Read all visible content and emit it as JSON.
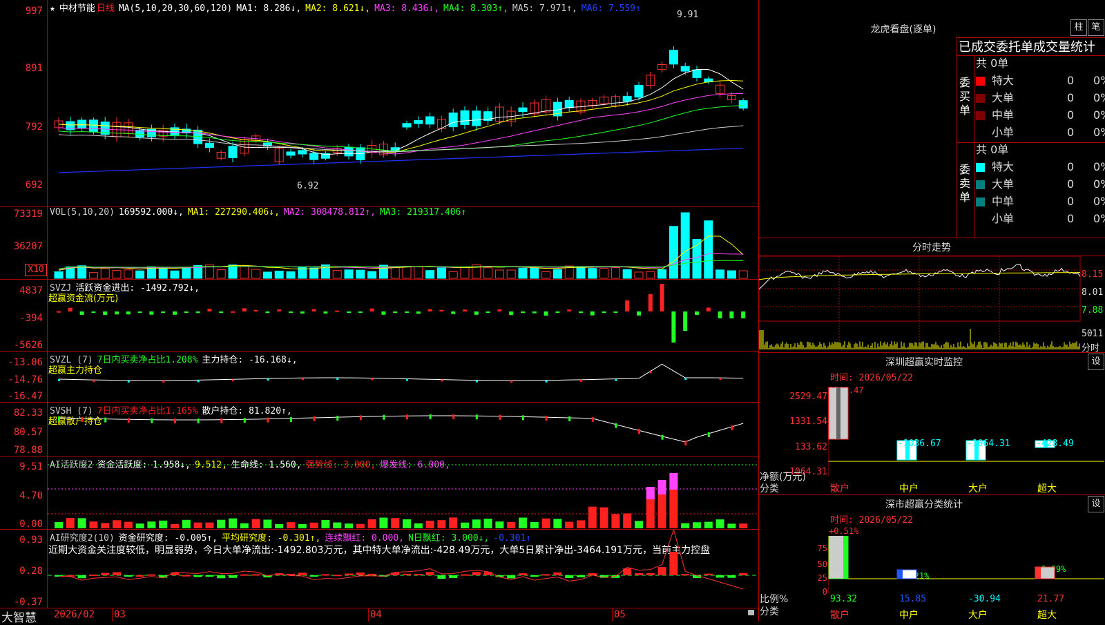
{
  "stock": {
    "star": "★",
    "name": "中材节能",
    "period": "日线",
    "ma_header": "MA(5,10,20,30,60,120)",
    "ma1": "MA1: 8.286↓,",
    "ma2": "MA2: 8.621↓,",
    "ma3": "MA3: 8.436↓,",
    "ma4": "MA4: 8.303↑,",
    "ma5": "MA5: 7.971↑,",
    "ma6": "MA6: 7.559↑",
    "high_mark": "9.91",
    "low_mark": "6.92"
  },
  "price_axis": [
    "997",
    "891",
    "792",
    "692"
  ],
  "vol": {
    "header": "VOL(5,10,20)",
    "val": "169592.000↓,",
    "ma1": "MA1: 227290.406↓,",
    "ma2": "MA2: 308478.812↑,",
    "ma3": "MA3: 219317.406↑",
    "axis": [
      "73319",
      "36207"
    ],
    "unit": "X10"
  },
  "svzj": {
    "header": "SVZJ",
    "t1": "活跃资金进出: -1492.792↓,",
    "t2": "超赢资金流(万元)",
    "axis": [
      "4837",
      "-394",
      "-5626"
    ]
  },
  "svzl": {
    "header": "SVZL (7)",
    "t1": "7日内买卖净占比1.208%",
    "t2": "主力持仓: -16.168↓,",
    "t3": "超赢主力持仓",
    "axis": [
      "-13.06",
      "-14.76",
      "-16.47"
    ]
  },
  "svsh": {
    "header": "SVSH (7)",
    "t1": "7日内买卖净占比1.165%",
    "t2": "散户持仓: 81.820↑,",
    "t3": "超赢散户持仓",
    "axis": [
      "82.33",
      "80.57",
      "78.88"
    ]
  },
  "ai1": {
    "header": "AI活跃度2",
    "t1": "资金活跃度: 1.958↓,",
    "t2": "9.512,",
    "t3": "生命线: 1.560,",
    "t4": "强势线: 3.000,",
    "t5": "爆发线: 6.000,",
    "axis": [
      "9.51",
      "4.70",
      "0.00"
    ]
  },
  "ai2": {
    "header": "AI研究度2(10)",
    "t1": "资金研究度: -0.005↑,",
    "t2": "平均研究度: -0.301↑,",
    "t3": "连续飘红: 0.000,",
    "t4": "N日飘红: 3.000↓,",
    "t5": "-0.301↑",
    "comment": "近期大资金关注度较低，明显弱势，今日大单净流出:-1492.803万元，其中特大单净流出:-428.49万元，大单5日累计净出-3464.191万元，当前主力控盘",
    "axis": [
      "0.93",
      "0.28",
      "-0.37"
    ]
  },
  "bottom": {
    "logo": "大智慧",
    "dates": [
      "2026/02",
      "03",
      "04",
      "05"
    ]
  },
  "right": {
    "lhb_title": "龙虎看盘(逐单)",
    "btn1": "柱",
    "btn2": "笔",
    "order_title": "已成交委托单成交量统计",
    "buy_label": "委买单",
    "sell_label": "委卖单",
    "buy_total": "共 0单",
    "sell_total": "共 0单",
    "rows": [
      "特大",
      "大单",
      "中单",
      "小单"
    ],
    "zero": "0",
    "pct": "0%",
    "buy_colors": [
      "#ff0000",
      "#800000",
      "#800000",
      "#000000"
    ],
    "sell_colors": [
      "#00ffff",
      "#008080",
      "#008080",
      "#000000"
    ],
    "fenshi_title": "分时走势",
    "fenshi_axis": [
      "8.15",
      "8.01",
      "7.88"
    ],
    "fenshi_vol": "5011",
    "fenshi_unit": "分时",
    "sz_title": "深圳超赢实时监控",
    "set": "设",
    "sz_time": "时间: 2026/05/22",
    "sz_axis": [
      "2529.47",
      "1331.54",
      "133.62",
      "-1064.31"
    ],
    "sz_top": "2529.47",
    "sz_vals": [
      "-1036.67",
      "-1064.31",
      "-428.49"
    ],
    "net_label": "净额(万元)",
    "cat_label": "分类",
    "cats": [
      "散户",
      "中户",
      "大户",
      "超大"
    ],
    "sh_title": "深市超赢分类统计",
    "sh_time": "时间: 2026/05/22",
    "sh_top": "+0.51%",
    "sh_mid": "-0.21%",
    "sh_right": "-0.09%",
    "sh_axis": [
      "75",
      "50",
      "25",
      "0"
    ],
    "ratio_label": "比例%",
    "sh_bottom": [
      "93.32",
      "15.85",
      "-30.94",
      "21.77"
    ]
  }
}
